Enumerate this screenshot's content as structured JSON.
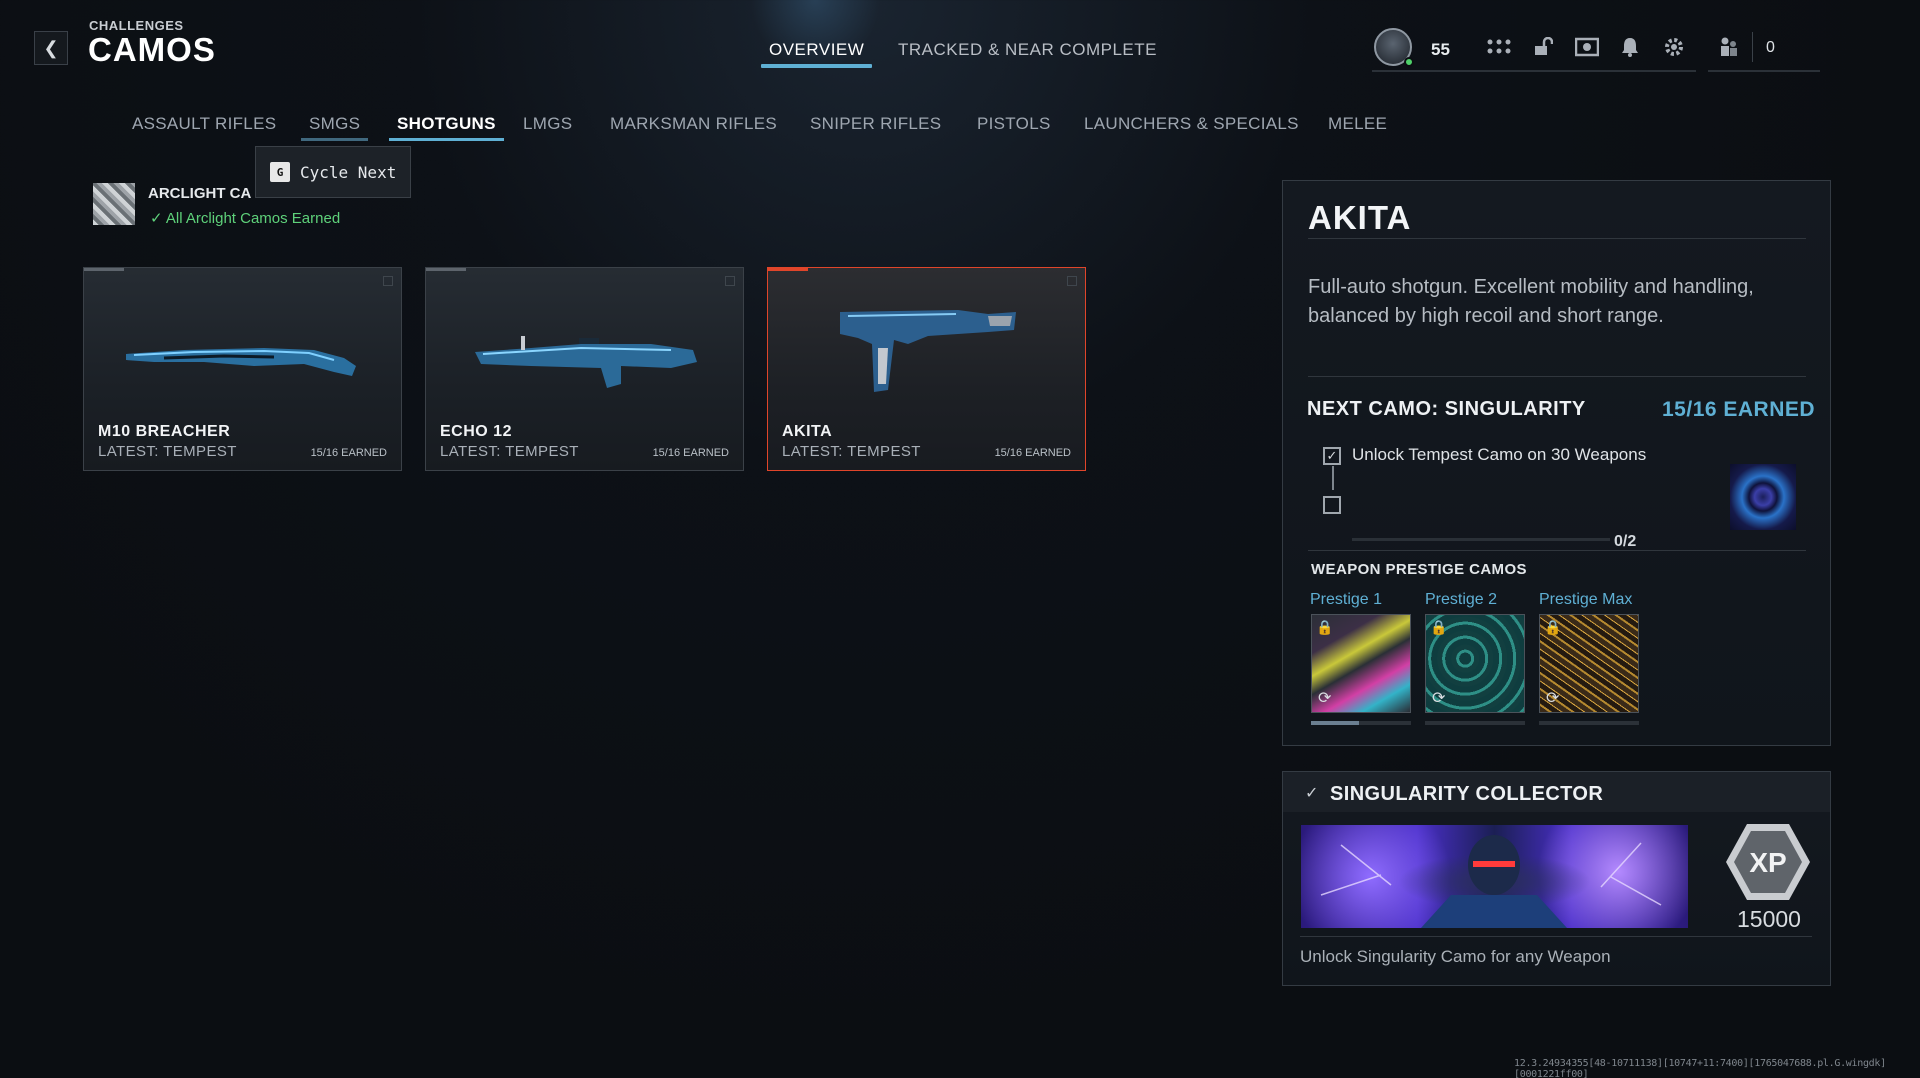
{
  "header": {
    "breadcrumb": "CHALLENGES",
    "title": "CAMOS",
    "top_tabs": [
      {
        "label": "OVERVIEW",
        "active": true
      },
      {
        "label": "TRACKED & NEAR COMPLETE",
        "active": false
      }
    ],
    "level": "55",
    "friends_count": "0"
  },
  "categories": [
    {
      "label": "ASSAULT RIFLES"
    },
    {
      "label": "SMGS"
    },
    {
      "label": "SHOTGUNS",
      "active": true
    },
    {
      "label": "LMGS"
    },
    {
      "label": "MARKSMAN RIFLES"
    },
    {
      "label": "SNIPER RIFLES"
    },
    {
      "label": "PISTOLS"
    },
    {
      "label": "LAUNCHERS & SPECIALS"
    },
    {
      "label": "MELEE"
    }
  ],
  "tooltip": {
    "key": "G",
    "label": "Cycle Next"
  },
  "arclight": {
    "title": "ARCLIGHT CA",
    "status": "All Arclight Camos Earned"
  },
  "weapons": [
    {
      "name": "M10 BREACHER",
      "latest": "LATEST: TEMPEST",
      "earned": "15/16 EARNED"
    },
    {
      "name": "ECHO 12",
      "latest": "LATEST: TEMPEST",
      "earned": "15/16 EARNED"
    },
    {
      "name": "AKITA",
      "latest": "LATEST: TEMPEST",
      "earned": "15/16 EARNED",
      "selected": true
    }
  ],
  "detail": {
    "title": "AKITA",
    "description": "Full-auto shotgun. Excellent mobility and handling, balanced by high recoil and short range.",
    "next_camo_label": "NEXT CAMO: SINGULARITY",
    "next_camo_earned": "15/16 EARNED",
    "task": "Unlock Tempest Camo on 30 Weapons",
    "progress": "0/2",
    "prestige_heading": "WEAPON PRESTIGE CAMOS",
    "prestige": [
      {
        "label": "Prestige 1"
      },
      {
        "label": "Prestige 2"
      },
      {
        "label": "Prestige Max"
      }
    ]
  },
  "collector": {
    "title": "SINGULARITY COLLECTOR",
    "xp_badge": "XP",
    "xp": "15000",
    "description": "Unlock Singularity Camo for any Weapon"
  },
  "footer": "12.3.24934355[48-10711138][10747+11:7400][1765047688.pl.G.wingdk][0001221ff00]",
  "colors": {
    "accent": "#5fb0d4",
    "selected_border": "#e0452a",
    "success": "#5ed17a"
  }
}
